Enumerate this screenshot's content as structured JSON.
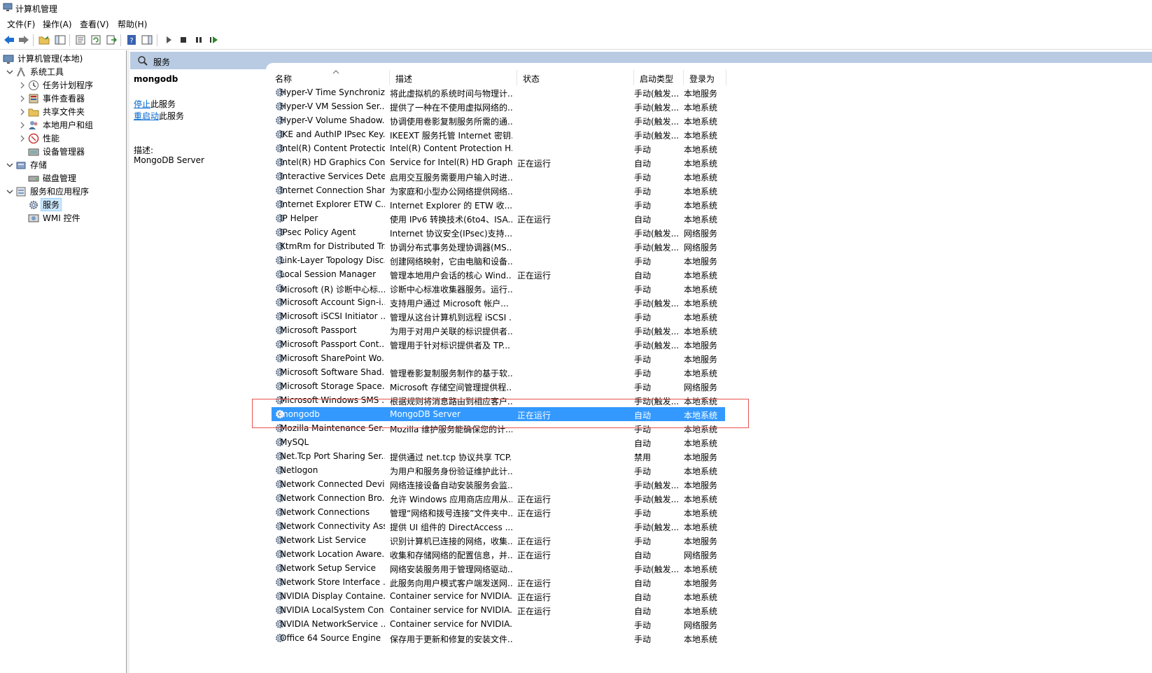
{
  "window": {
    "title": "计算机管理"
  },
  "menu": [
    "文件(F)",
    "操作(A)",
    "查看(V)",
    "帮助(H)"
  ],
  "toolbar": [
    "back-icon",
    "forward-icon",
    "up-folder-icon",
    "console-tree-icon",
    "properties-icon",
    "refresh-icon",
    "export-icon",
    "help-icon",
    "show-hide-icon",
    "start-icon",
    "stop-icon",
    "pause-icon",
    "restart-icon"
  ],
  "tree": [
    {
      "label": "计算机管理(本地)",
      "level": 0,
      "twisty": "",
      "icon": "computer-management-icon"
    },
    {
      "label": "系统工具",
      "level": 1,
      "twisty": "expanded",
      "icon": "system-tools-icon"
    },
    {
      "label": "任务计划程序",
      "level": 2,
      "twisty": "collapsed",
      "icon": "task-scheduler-icon"
    },
    {
      "label": "事件查看器",
      "level": 2,
      "twisty": "collapsed",
      "icon": "event-viewer-icon"
    },
    {
      "label": "共享文件夹",
      "level": 2,
      "twisty": "collapsed",
      "icon": "shared-folders-icon"
    },
    {
      "label": "本地用户和组",
      "level": 2,
      "twisty": "collapsed",
      "icon": "local-users-icon"
    },
    {
      "label": "性能",
      "level": 2,
      "twisty": "collapsed",
      "icon": "performance-icon"
    },
    {
      "label": "设备管理器",
      "level": 2,
      "twisty": "",
      "icon": "device-manager-icon"
    },
    {
      "label": "存储",
      "level": 1,
      "twisty": "expanded",
      "icon": "storage-icon"
    },
    {
      "label": "磁盘管理",
      "level": 2,
      "twisty": "",
      "icon": "disk-management-icon"
    },
    {
      "label": "服务和应用程序",
      "level": 1,
      "twisty": "expanded",
      "icon": "services-apps-icon"
    },
    {
      "label": "服务",
      "level": 2,
      "twisty": "",
      "icon": "services-icon",
      "selected": true
    },
    {
      "label": "WMI 控件",
      "level": 2,
      "twisty": "",
      "icon": "wmi-control-icon"
    }
  ],
  "services_header": {
    "title": "服务"
  },
  "detail": {
    "service_name": "mongodb",
    "stop_link": "停止",
    "stop_suffix": "此服务",
    "restart_link": "重启动",
    "restart_suffix": "此服务",
    "desc_label": "描述:",
    "desc_value": "MongoDB Server"
  },
  "columns": [
    "名称",
    "描述",
    "状态",
    "启动类型",
    "登录为"
  ],
  "colors": {
    "selection": "#3399ff",
    "header_band": "#b9cbe3",
    "highlight_box": "#e8544e",
    "link": "#0066cc"
  },
  "rows": [
    [
      "Hyper-V Time Synchroniz...",
      "将此虚拟机的系统时间与物理计...",
      "",
      "手动(触发...",
      "本地服务"
    ],
    [
      "Hyper-V VM Session Ser...",
      "提供了一种在不使用虚拟网络的...",
      "",
      "手动(触发...",
      "本地系统"
    ],
    [
      "Hyper-V Volume Shadow...",
      "协调使用卷影复制服务所需的通...",
      "",
      "手动(触发...",
      "本地系统"
    ],
    [
      "IKE and AuthIP IPsec Key...",
      "IKEEXT 服务托管 Internet 密钥...",
      "",
      "手动(触发...",
      "本地系统"
    ],
    [
      "Intel(R) Content Protectio...",
      "Intel(R) Content Protection H...",
      "",
      "手动",
      "本地系统"
    ],
    [
      "Intel(R) HD Graphics Con...",
      "Service for Intel(R) HD Graph...",
      "正在运行",
      "自动",
      "本地系统"
    ],
    [
      "Interactive Services Dete...",
      "启用交互服务需要用户输入时进...",
      "",
      "手动",
      "本地系统"
    ],
    [
      "Internet Connection Shari...",
      "为家庭和小型办公网络提供网络...",
      "",
      "手动",
      "本地系统"
    ],
    [
      "Internet Explorer ETW C...",
      "Internet Explorer 的 ETW 收...",
      "",
      "手动",
      "本地系统"
    ],
    [
      "IP Helper",
      "使用 IPv6 转换技术(6to4、ISA...",
      "正在运行",
      "自动",
      "本地系统"
    ],
    [
      "IPsec Policy Agent",
      "Internet 协议安全(IPsec)支持...",
      "",
      "手动(触发...",
      "网络服务"
    ],
    [
      "KtmRm for Distributed Tr...",
      "协调分布式事务处理协调器(MS...",
      "",
      "手动(触发...",
      "网络服务"
    ],
    [
      "Link-Layer Topology Disc...",
      "创建网络映射，它由电脑和设备...",
      "",
      "手动",
      "本地服务"
    ],
    [
      "Local Session Manager",
      "管理本地用户会话的核心 Wind...",
      "正在运行",
      "自动",
      "本地系统"
    ],
    [
      "Microsoft (R) 诊断中心标...",
      "诊断中心标准收集器服务。运行...",
      "",
      "手动",
      "本地系统"
    ],
    [
      "Microsoft Account Sign-i...",
      "支持用户通过 Microsoft 帐户...",
      "",
      "手动(触发...",
      "本地系统"
    ],
    [
      "Microsoft iSCSI Initiator ...",
      "管理从这台计算机到远程 iSCSI ...",
      "",
      "手动",
      "本地系统"
    ],
    [
      "Microsoft Passport",
      "为用于对用户关联的标识提供者...",
      "",
      "手动(触发...",
      "本地系统"
    ],
    [
      "Microsoft Passport Cont...",
      "管理用于针对标识提供者及 TP...",
      "",
      "手动(触发...",
      "本地服务"
    ],
    [
      "Microsoft SharePoint Wo...",
      "",
      "",
      "手动",
      "本地服务"
    ],
    [
      "Microsoft Software Shad...",
      "管理卷影复制服务制作的基于软...",
      "",
      "手动",
      "本地系统"
    ],
    [
      "Microsoft Storage Space...",
      "Microsoft 存储空间管理提供程...",
      "",
      "手动",
      "网络服务"
    ],
    [
      "Microsoft Windows SMS ...",
      "根据规则将消息路由到相应客户...",
      "",
      "手动(触发...",
      "本地系统"
    ],
    [
      "mongodb",
      "MongoDB Server",
      "正在运行",
      "自动",
      "本地系统"
    ],
    [
      "Mozilla Maintenance Ser...",
      "Mozilla 维护服务能确保您的计...",
      "",
      "手动",
      "本地系统"
    ],
    [
      "MySQL",
      "",
      "",
      "自动",
      "本地系统"
    ],
    [
      "Net.Tcp Port Sharing Ser...",
      "提供通过 net.tcp 协议共享 TCP...",
      "",
      "禁用",
      "本地服务"
    ],
    [
      "Netlogon",
      "为用户和服务身份验证维护此计...",
      "",
      "手动",
      "本地系统"
    ],
    [
      "Network Connected Devi...",
      "网络连接设备自动安装服务会监...",
      "",
      "手动(触发...",
      "本地服务"
    ],
    [
      "Network Connection Bro...",
      "允许 Windows 应用商店应用从...",
      "正在运行",
      "手动(触发...",
      "本地系统"
    ],
    [
      "Network Connections",
      "管理“网络和拨号连接”文件夹中...",
      "正在运行",
      "手动",
      "本地系统"
    ],
    [
      "Network Connectivity Ass...",
      "提供 UI 组件的 DirectAccess ...",
      "",
      "手动(触发...",
      "本地系统"
    ],
    [
      "Network List Service",
      "识别计算机已连接的网络，收集...",
      "正在运行",
      "手动",
      "本地服务"
    ],
    [
      "Network Location Aware...",
      "收集和存储网络的配置信息，并...",
      "正在运行",
      "自动",
      "网络服务"
    ],
    [
      "Network Setup Service",
      "网络安装服务用于管理网络驱动...",
      "",
      "手动(触发...",
      "本地系统"
    ],
    [
      "Network Store Interface ...",
      "此服务向用户模式客户端发送网...",
      "正在运行",
      "自动",
      "本地服务"
    ],
    [
      "NVIDIA Display Containe...",
      "Container service for NVIDIA...",
      "正在运行",
      "自动",
      "本地系统"
    ],
    [
      "NVIDIA LocalSystem Con...",
      "Container service for NVIDIA...",
      "正在运行",
      "自动",
      "本地系统"
    ],
    [
      "NVIDIA NetworkService ...",
      "Container service for NVIDIA...",
      "",
      "手动",
      "网络服务"
    ],
    [
      "Office 64 Source Engine",
      "保存用于更新和修复的安装文件...",
      "",
      "手动",
      "本地系统"
    ]
  ]
}
